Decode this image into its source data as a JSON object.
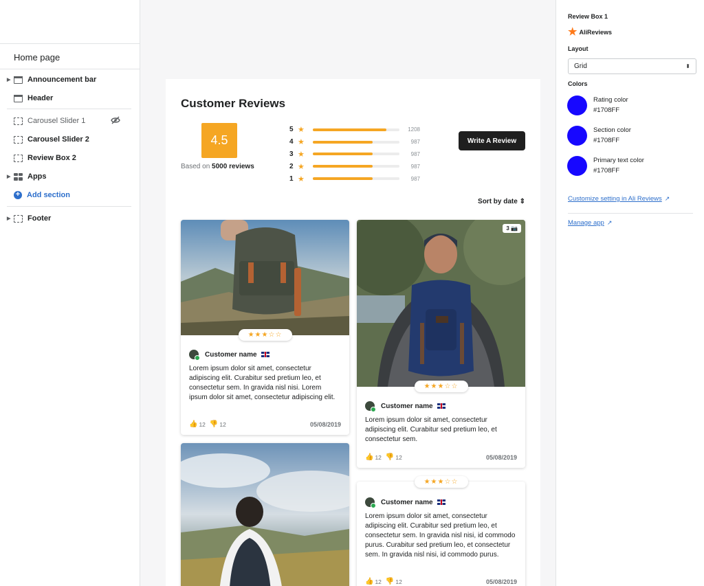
{
  "sidebar": {
    "home_label": "Home page",
    "items": [
      {
        "label": "Announcement bar"
      },
      {
        "label": "Header"
      },
      {
        "label": "Carousel Slider 1"
      },
      {
        "label": "Carousel Slider 2"
      },
      {
        "label": "Review Box 2"
      },
      {
        "label": "Apps"
      },
      {
        "label": "Add section"
      },
      {
        "label": "Footer"
      }
    ]
  },
  "reviews": {
    "title": "Customer Reviews",
    "score": "4.5",
    "based_prefix": "Based on ",
    "based_count": "5000 reviews",
    "write_button": "Write A Review",
    "sort_label": "Sort by date",
    "rating_bars": [
      {
        "stars": "5",
        "count": "1208",
        "fraction": 0.85
      },
      {
        "stars": "4",
        "count": "987",
        "fraction": 0.69
      },
      {
        "stars": "3",
        "count": "987",
        "fraction": 0.69
      },
      {
        "stars": "2",
        "count": "987",
        "fraction": 0.69
      },
      {
        "stars": "1",
        "count": "987",
        "fraction": 0.69
      }
    ],
    "cards": [
      {
        "name": "Customer name",
        "text": "Lorem ipsum dolor sit amet, consectetur adipiscing elit. Curabitur sed pretium leo, et consectetur sem. In gravida nisl nisi. Lorem ipsum dolor sit amet, consectetur adipiscing elit.",
        "likes": "12",
        "dislikes": "12",
        "date": "05/08/2019",
        "rating": 3
      },
      {
        "name": "Customer name",
        "text": "Lorem ipsum dolor sit amet, consectetur adipiscing elit. Curabitur sed pretium leo, et consectetur sem.",
        "likes": "12",
        "dislikes": "12",
        "date": "05/08/2019",
        "rating": 3,
        "photo_count": "3"
      },
      {
        "name": "Customer name",
        "text": "Lorem ipsum dolor sit amet, consectetur adipiscing elit. Curabitur sed pretium leo, et consectetur sem. In gravida nisl nisi, id commodo purus. Curabitur sed pretium leo, et consectetur sem. In gravida nisl nisi, id commodo purus.",
        "likes": "12",
        "dislikes": "12",
        "date": "05/08/2019",
        "rating": 3
      }
    ]
  },
  "panel": {
    "title": "Review Box 1",
    "brand": "AliReviews",
    "layout_label": "Layout",
    "layout_value": "Grid",
    "colors_label": "Colors",
    "colors": [
      {
        "label": "Rating color",
        "value": "#1708FF"
      },
      {
        "label": "Section color",
        "value": "#1708FF"
      },
      {
        "label": "Primary text color",
        "value": "#1708FF"
      }
    ],
    "customize_link": "Customize setting in Ali Reviews",
    "manage_link": "Manage app"
  }
}
